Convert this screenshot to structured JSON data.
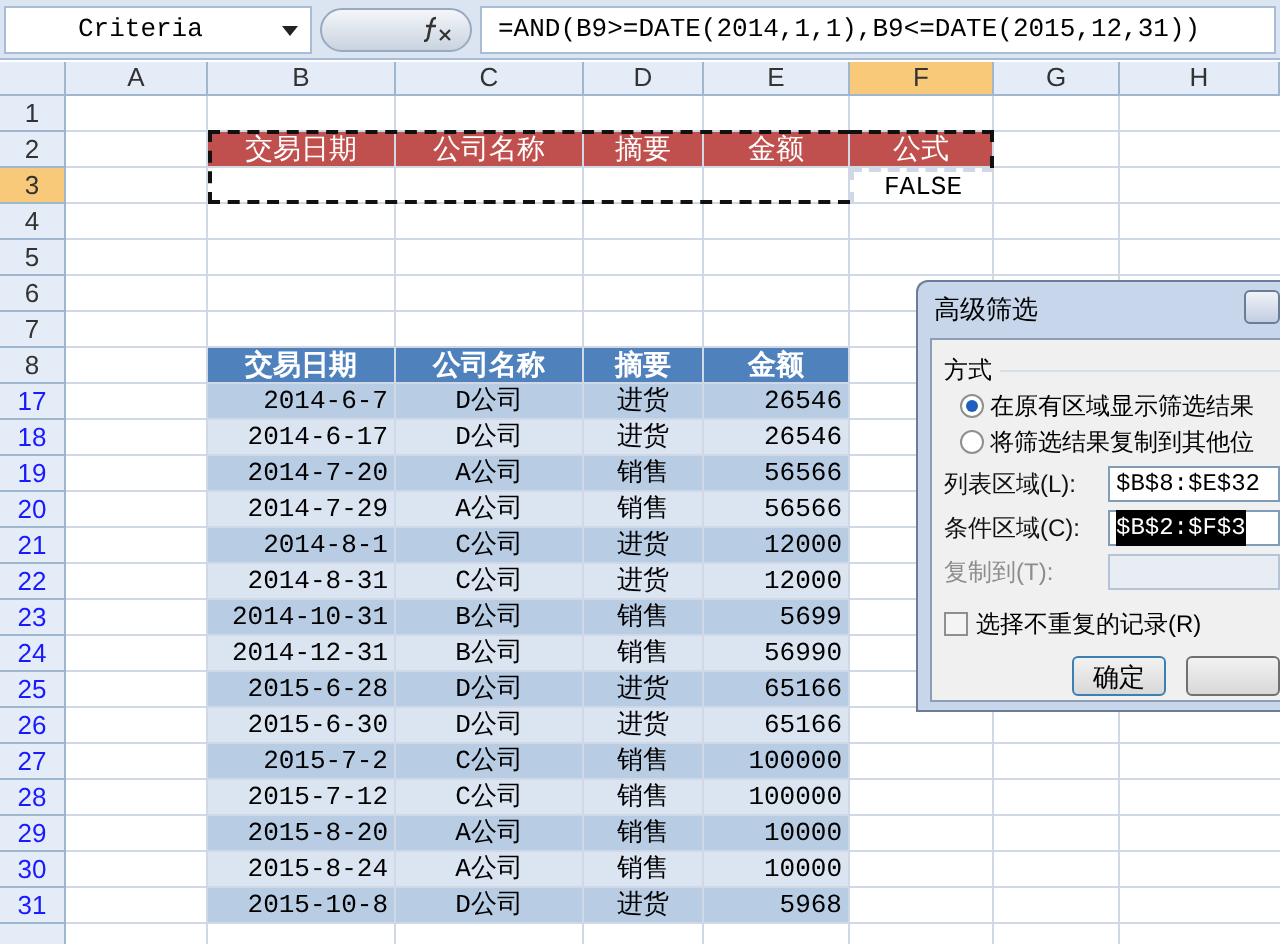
{
  "name_box": {
    "value": "Criteria"
  },
  "formula": "=AND(B9>=DATE(2014,1,1),B9<=DATE(2015,12,31))",
  "columns": [
    {
      "label": "A",
      "selected": false
    },
    {
      "label": "B",
      "selected": false
    },
    {
      "label": "C",
      "selected": false
    },
    {
      "label": "D",
      "selected": false
    },
    {
      "label": "E",
      "selected": false
    },
    {
      "label": "F",
      "selected": true
    },
    {
      "label": "G",
      "selected": false
    },
    {
      "label": "H",
      "selected": false
    }
  ],
  "rows": [
    {
      "number": "1",
      "selected": false,
      "filtered": false,
      "kind": "blank"
    },
    {
      "number": "2",
      "selected": false,
      "filtered": false,
      "kind": "criteria_header",
      "cells": [
        "交易日期",
        "公司名称",
        "摘要",
        "金额",
        "公式"
      ]
    },
    {
      "number": "3",
      "selected": true,
      "filtered": false,
      "kind": "criteria_value",
      "result": "FALSE"
    },
    {
      "number": "4",
      "selected": false,
      "filtered": false,
      "kind": "blank"
    },
    {
      "number": "5",
      "selected": false,
      "filtered": false,
      "kind": "blank"
    },
    {
      "number": "6",
      "selected": false,
      "filtered": false,
      "kind": "blank"
    },
    {
      "number": "7",
      "selected": false,
      "filtered": false,
      "kind": "blank"
    },
    {
      "number": "8",
      "selected": false,
      "filtered": false,
      "kind": "list_header",
      "cells": [
        "交易日期",
        "公司名称",
        "摘要",
        "金额"
      ]
    },
    {
      "number": "17",
      "selected": false,
      "filtered": true,
      "kind": "data",
      "cells": [
        "2014-6-7",
        "D公司",
        "进货",
        "26546"
      ]
    },
    {
      "number": "18",
      "selected": false,
      "filtered": true,
      "kind": "data",
      "cells": [
        "2014-6-17",
        "D公司",
        "进货",
        "26546"
      ]
    },
    {
      "number": "19",
      "selected": false,
      "filtered": true,
      "kind": "data",
      "cells": [
        "2014-7-20",
        "A公司",
        "销售",
        "56566"
      ]
    },
    {
      "number": "20",
      "selected": false,
      "filtered": true,
      "kind": "data",
      "cells": [
        "2014-7-29",
        "A公司",
        "销售",
        "56566"
      ]
    },
    {
      "number": "21",
      "selected": false,
      "filtered": true,
      "kind": "data",
      "cells": [
        "2014-8-1",
        "C公司",
        "进货",
        "12000"
      ]
    },
    {
      "number": "22",
      "selected": false,
      "filtered": true,
      "kind": "data",
      "cells": [
        "2014-8-31",
        "C公司",
        "进货",
        "12000"
      ]
    },
    {
      "number": "23",
      "selected": false,
      "filtered": true,
      "kind": "data",
      "cells": [
        "2014-10-31",
        "B公司",
        "销售",
        "5699"
      ]
    },
    {
      "number": "24",
      "selected": false,
      "filtered": true,
      "kind": "data",
      "cells": [
        "2014-12-31",
        "B公司",
        "销售",
        "56990"
      ]
    },
    {
      "number": "25",
      "selected": false,
      "filtered": true,
      "kind": "data",
      "cells": [
        "2015-6-28",
        "D公司",
        "进货",
        "65166"
      ]
    },
    {
      "number": "26",
      "selected": false,
      "filtered": true,
      "kind": "data",
      "cells": [
        "2015-6-30",
        "D公司",
        "进货",
        "65166"
      ]
    },
    {
      "number": "27",
      "selected": false,
      "filtered": true,
      "kind": "data",
      "cells": [
        "2015-7-2",
        "C公司",
        "销售",
        "100000"
      ]
    },
    {
      "number": "28",
      "selected": false,
      "filtered": true,
      "kind": "data",
      "cells": [
        "2015-7-12",
        "C公司",
        "销售",
        "100000"
      ]
    },
    {
      "number": "29",
      "selected": false,
      "filtered": true,
      "kind": "data",
      "cells": [
        "2015-8-20",
        "A公司",
        "销售",
        "10000"
      ]
    },
    {
      "number": "30",
      "selected": false,
      "filtered": true,
      "kind": "data",
      "cells": [
        "2015-8-24",
        "A公司",
        "销售",
        "10000"
      ]
    },
    {
      "number": "31",
      "selected": false,
      "filtered": true,
      "kind": "data",
      "cells": [
        "2015-10-8",
        "D公司",
        "进货",
        "5968"
      ]
    }
  ],
  "dialog": {
    "title": "高级筛选",
    "group_label": "方式",
    "options": [
      {
        "label": "在原有区域显示筛选结果",
        "selected": true
      },
      {
        "label": "将筛选结果复制到其他位",
        "selected": false
      }
    ],
    "fields": [
      {
        "label": "列表区域(L):",
        "value": "$B$8:$E$32",
        "disabled": false,
        "highlighted": false
      },
      {
        "label": "条件区域(C):",
        "value": "$B$2:$F$3",
        "disabled": false,
        "highlighted": true
      },
      {
        "label": "复制到(T):",
        "disabled": true,
        "highlighted": false
      }
    ],
    "checkbox": {
      "label": "选择不重复的记录(R)",
      "checked": false
    },
    "buttons": [
      {
        "label": "确定",
        "default": true
      },
      {
        "default": false
      }
    ]
  }
}
